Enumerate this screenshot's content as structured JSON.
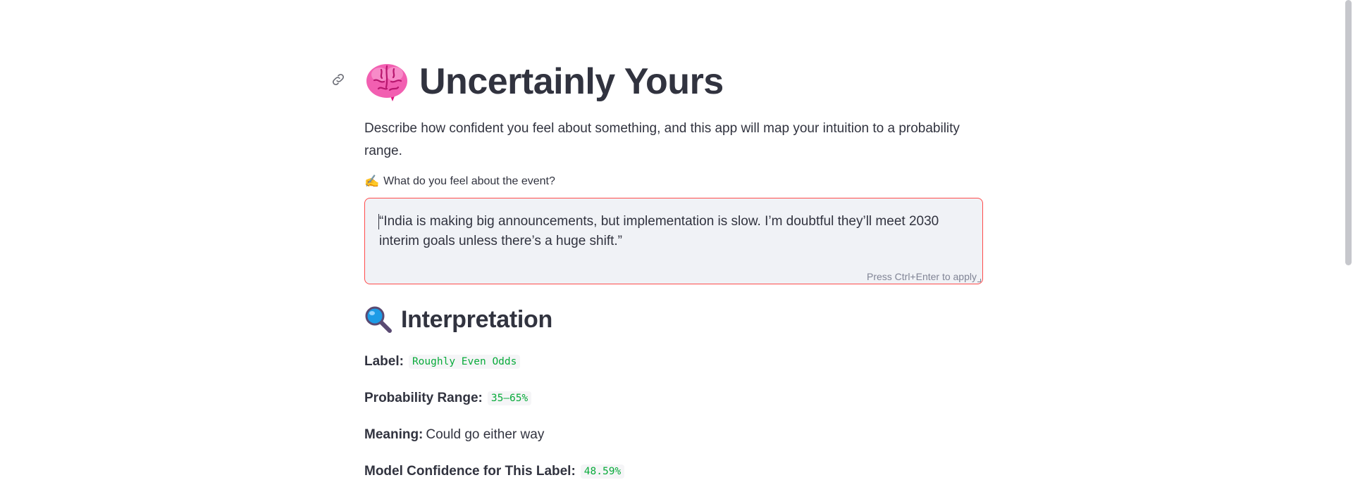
{
  "header": {
    "title": "Uncertainly Yours",
    "title_icon": "brain-emoji",
    "anchor_icon": "link-icon"
  },
  "intro": {
    "description": "Describe how confident you feel about something, and this app will map your intuition to a probability range."
  },
  "input": {
    "label_icon": "writing-hand-emoji",
    "label": "What do you feel about the event?",
    "value": "“India is making big announcements, but implementation is slow. I’m doubtful they’ll meet 2030 interim goals unless there’s a huge shift.”",
    "hint": "Press Ctrl+Enter to apply",
    "border_color": "#ff4b4b"
  },
  "interpretation": {
    "title_icon": "magnifying-glass-emoji",
    "title": "Interpretation",
    "label_key": "Label:",
    "label_value": "Roughly Even Odds",
    "range_key": "Probability Range:",
    "range_value": "35–65%",
    "meaning_key": "Meaning:",
    "meaning_value": "Could go either way",
    "confidence_key": "Model Confidence for This Label:",
    "confidence_value": "48.59%",
    "code_color": "#09ab3b"
  }
}
